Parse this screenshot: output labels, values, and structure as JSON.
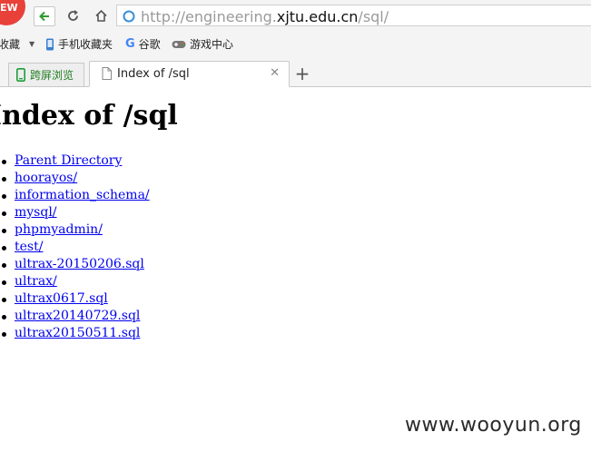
{
  "browser": {
    "badge_text": "EW",
    "url_prefix": "http://engineering.",
    "url_domain": "xjtu.edu.cn",
    "url_suffix": "/sql/"
  },
  "bookmarks": {
    "favorites_label": "收藏",
    "items": [
      {
        "label": "手机收藏夹",
        "icon": "phone-icon"
      },
      {
        "label": "谷歌",
        "icon": "google-icon"
      },
      {
        "label": "游戏中心",
        "icon": "gamepad-icon"
      }
    ]
  },
  "tabs": [
    {
      "label": "跨屏浏览",
      "icon": "phone-icon",
      "active": false
    },
    {
      "label": "Index of /sql",
      "icon": "document-icon",
      "active": true
    }
  ],
  "page": {
    "heading": "Index of /sql",
    "entries": [
      "Parent Directory",
      "hoorayos/",
      "information_schema/",
      "mysql/",
      "phpmyadmin/",
      "test/",
      "ultrax-20150206.sql",
      "ultrax/",
      "ultrax0617.sql",
      "ultrax20140729.sql",
      "ultrax20150511.sql"
    ]
  },
  "watermark": "www.wooyun.org",
  "colors": {
    "link": "#0000ee",
    "badge": "#e8413a",
    "back_arrow": "#2e9b2e"
  }
}
